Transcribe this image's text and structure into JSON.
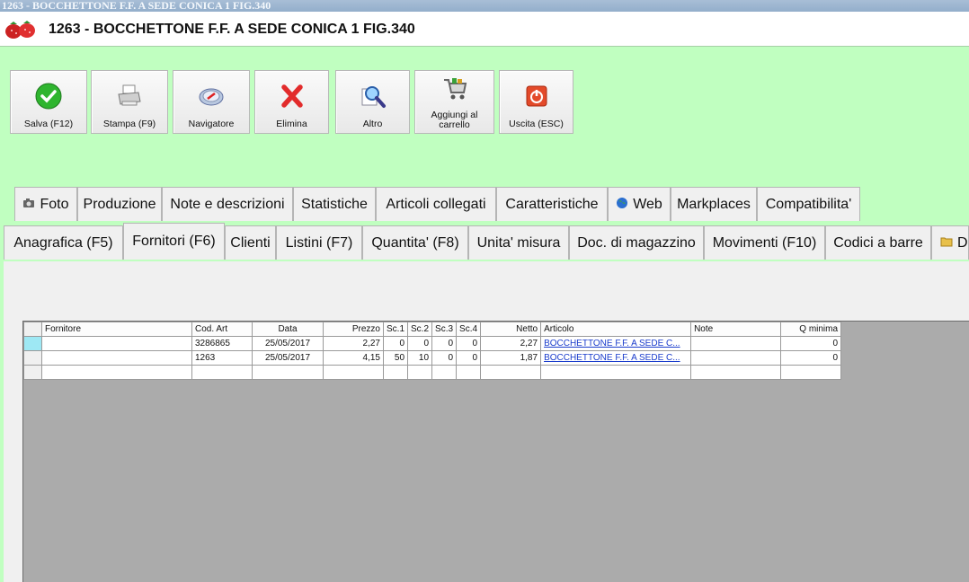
{
  "window": {
    "title": "1263 - BOCCHETTONE F.F. A SEDE CONICA 1 FIG.340"
  },
  "header": {
    "title": "1263 - BOCCHETTONE F.F. A SEDE CONICA 1 FIG.340",
    "logo_icon": "strawberry-logo"
  },
  "colors": {
    "background": "#c0ffc0",
    "link": "#1a3ccc",
    "selected_indicator": "#9ee8f4"
  },
  "toolbar": {
    "buttons": [
      {
        "label": "Salva (F12)",
        "icon": "check-icon"
      },
      {
        "label": "Stampa (F9)",
        "icon": "printer-icon"
      },
      {
        "label": "Navigatore",
        "icon": "compass-icon"
      },
      {
        "label": "Elimina",
        "icon": "delete-x-icon"
      },
      {
        "label": "Altro",
        "icon": "magnifier-icon"
      },
      {
        "label": "Aggiungi al carrello",
        "icon": "cart-icon"
      },
      {
        "label": "Uscita (ESC)",
        "icon": "power-icon"
      }
    ]
  },
  "tabs_row1": [
    {
      "label": "Foto",
      "icon": "camera-icon"
    },
    {
      "label": "Produzione"
    },
    {
      "label": "Note e descrizioni"
    },
    {
      "label": "Statistiche"
    },
    {
      "label": "Articoli collegati"
    },
    {
      "label": "Caratteristiche"
    },
    {
      "label": "Web",
      "icon": "globe-icon"
    },
    {
      "label": "Markplaces"
    },
    {
      "label": "Compatibilita'"
    }
  ],
  "tabs_row2": [
    {
      "label": "Anagrafica (F5)"
    },
    {
      "label": "Fornitori (F6)",
      "active": true
    },
    {
      "label": "Clienti"
    },
    {
      "label": "Listini (F7)"
    },
    {
      "label": "Quantita' (F8)"
    },
    {
      "label": "Unita' misura"
    },
    {
      "label": "Doc. di magazzino"
    },
    {
      "label": "Movimenti (F10)"
    },
    {
      "label": "Codici a barre"
    },
    {
      "label": "D",
      "icon": "folder-icon"
    }
  ],
  "grid": {
    "columns": [
      "Fornitore",
      "Cod. Art",
      "Data",
      "Prezzo",
      "Sc.1",
      "Sc.2",
      "Sc.3",
      "Sc.4",
      "Netto",
      "Articolo",
      "Note",
      "Q minima"
    ],
    "rows": [
      {
        "fornitore": "",
        "cod_art": "3286865",
        "data": "25/05/2017",
        "prezzo": "2,27",
        "sc1": "0",
        "sc2": "0",
        "sc3": "0",
        "sc4": "0",
        "netto": "2,27",
        "articolo": "BOCCHETTONE F.F. A SEDE C...",
        "note": "",
        "q_minima": "0"
      },
      {
        "fornitore": "",
        "cod_art": "1263",
        "data": "25/05/2017",
        "prezzo": "4,15",
        "sc1": "50",
        "sc2": "10",
        "sc3": "0",
        "sc4": "0",
        "netto": "1,87",
        "articolo": "BOCCHETTONE F.F. A SEDE C...",
        "note": "",
        "q_minima": "0"
      }
    ]
  }
}
